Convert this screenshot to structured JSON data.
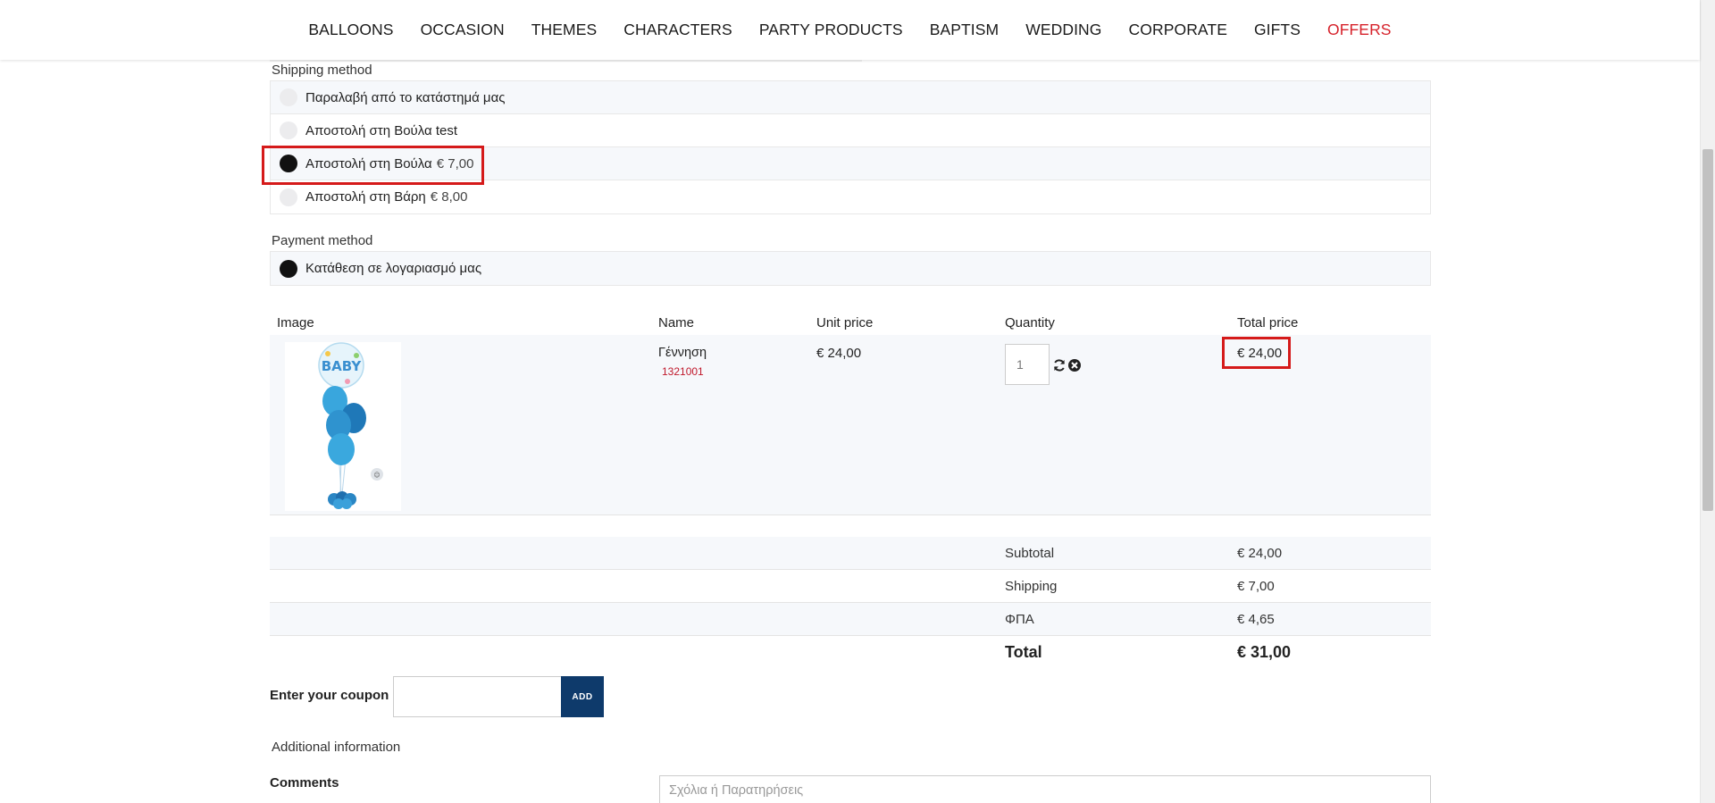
{
  "nav": {
    "items": [
      "BALLOONS",
      "OCCASION",
      "THEMES",
      "CHARACTERS",
      "PARTY PRODUCTS",
      "BAPTISM",
      "WEDDING",
      "CORPORATE",
      "GIFTS"
    ],
    "offers": "OFFERS",
    "offers_color": "#d6222b"
  },
  "shipping": {
    "title": "Shipping method",
    "options": [
      {
        "label": "Παραλαβή από το κατάστημά μας",
        "price": "",
        "selected": false
      },
      {
        "label": "Αποστολή στη Βούλα test",
        "price": "",
        "selected": false
      },
      {
        "label": "Αποστολή στη Βούλα",
        "price": "€ 7,00",
        "selected": true
      },
      {
        "label": "Αποστολή στη Βάρη",
        "price": "€ 8,00",
        "selected": false
      }
    ]
  },
  "payment": {
    "title": "Payment method",
    "options": [
      {
        "label": "Κατάθεση σε λογαριασμό μας",
        "selected": true
      }
    ]
  },
  "cart": {
    "headers": {
      "image": "Image",
      "name": "Name",
      "unit_price": "Unit price",
      "quantity": "Quantity",
      "total_price": "Total price"
    },
    "item": {
      "name": "Γέννηση",
      "sku": "1321001",
      "unit_price": "€ 24,00",
      "quantity": "1",
      "total_price": "€ 24,00",
      "image_icon": "baby-balloon-bouquet-image",
      "update_icon": "refresh-icon",
      "remove_icon": "remove-circle-icon"
    },
    "summary": {
      "subtotal_label": "Subtotal",
      "subtotal": "€ 24,00",
      "shipping_label": "Shipping",
      "shipping": "€ 7,00",
      "vat_label": "ΦΠΑ",
      "vat": "€ 4,65",
      "total_label": "Total",
      "total": "€ 31,00"
    }
  },
  "coupon": {
    "label": "Enter your coupon",
    "button": "ADD",
    "value": "",
    "button_color": "#0e3a6b"
  },
  "additional": {
    "title": "Additional information",
    "comments_label": "Comments",
    "comments_placeholder": "Σχόλια ή Παρατηρήσεις"
  },
  "highlight_color": "#d51a1a"
}
